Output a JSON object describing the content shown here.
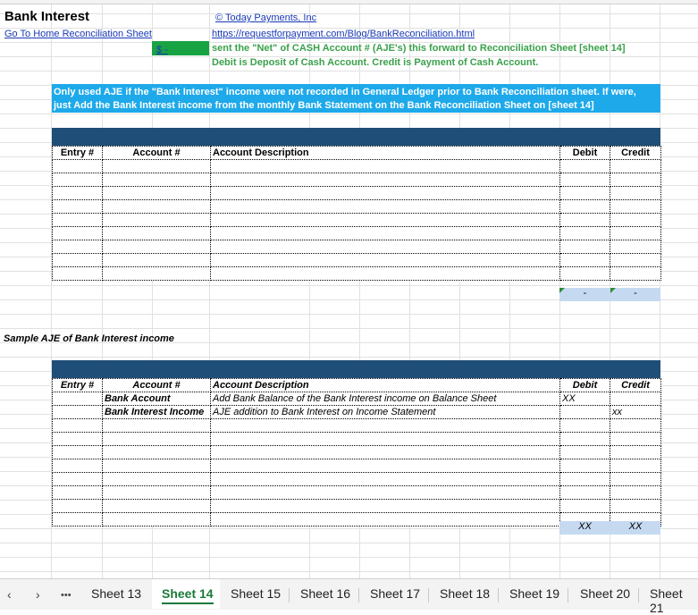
{
  "sheet": {
    "title": "Bank Interest",
    "copyright_link": "© Today Payments, Inc",
    "home_link": "Go To Home Reconciliation Sheet",
    "blog_link": "https://requestforpayment.com/Blog/BankReconciliation.html",
    "green_cell_value": "$           -",
    "note_line1": "sent the \"Net\" of CASH Account # (AJE's) this forward to Reconciliation Sheet [sheet 14]",
    "note_line2": "Debit is Deposit of Cash Account.  Credit is Payment of Cash Account.",
    "info_line1": "Only used AJE if the \"Bank Interest\" income were not recorded in General Ledger prior to Bank Reconciliation sheet.  If were,",
    "info_line2": "just Add the Bank Interest income from the monthly Bank Statement on the Bank Reconciliation Sheet on [sheet 14]",
    "sample_label": "Sample AJE of Bank Interest income"
  },
  "table1": {
    "headers": [
      "Entry #",
      "Account #",
      "Account Description",
      "Debit",
      "Credit"
    ],
    "total_debit": "-",
    "total_credit": "-"
  },
  "table2": {
    "headers": [
      "Entry #",
      "Account #",
      "Account Description",
      "Debit",
      "Credit"
    ],
    "rows": [
      {
        "entry": "",
        "account": "Bank Account",
        "description": "Add Bank Balance of the Bank Interest income on Balance Sheet",
        "debit": "XX",
        "credit": ""
      },
      {
        "entry": "",
        "account": "Bank Interest Income",
        "description": "AJE addition to Bank Interest on Income Statement",
        "debit": "",
        "credit": "xx"
      }
    ],
    "total_debit": "XX",
    "total_credit": "XX"
  },
  "tabs": {
    "more": "•••",
    "items": [
      "Sheet 13",
      "Sheet 14",
      "Sheet 15",
      "Sheet 16",
      "Sheet 17",
      "Sheet 18",
      "Sheet 19",
      "Sheet 20",
      "Sheet 21"
    ],
    "active": "Sheet 14"
  },
  "colors": {
    "accent_navy": "#1f4e79",
    "info_cyan": "#1ea9ea",
    "green": "#18a343",
    "total_fill": "#c5d9f1"
  }
}
